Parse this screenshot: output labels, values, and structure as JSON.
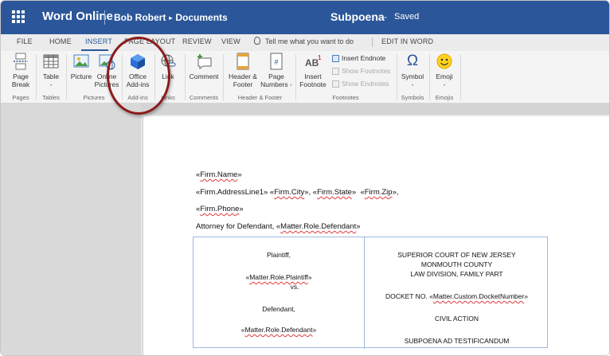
{
  "titlebar": {
    "app_name": "Word Online",
    "breadcrumb_user": "Bob Robert",
    "breadcrumb_arrow": "▸",
    "breadcrumb_folder": "Documents",
    "doc_name": "Subpoena",
    "doc_dash": "-",
    "doc_status": "Saved"
  },
  "tabs": {
    "file": "FILE",
    "home": "HOME",
    "insert": "INSERT",
    "page_layout": "PAGE LAYOUT",
    "review": "REVIEW",
    "view": "VIEW",
    "tell_me": "Tell me what you want to do",
    "edit_in_word": "EDIT IN WORD"
  },
  "ribbon": {
    "page_break": [
      "Page",
      "Break"
    ],
    "table": [
      "Table",
      "-"
    ],
    "picture": "Picture",
    "online_pictures": [
      "Online",
      "Pictures"
    ],
    "office_addins": [
      "Office",
      "Add-ins"
    ],
    "link": "Link",
    "comment": "Comment",
    "header_footer": [
      "Header &",
      "Footer"
    ],
    "page_numbers": [
      "Page",
      "Numbers -"
    ],
    "insert_footnote": [
      "Insert",
      "Footnote"
    ],
    "insert_endnote": "Insert Endnote",
    "show_footnotes": "Show Footnotes",
    "show_endnotes": "Show Endnotes",
    "symbol": [
      "Symbol",
      "-"
    ],
    "emoji": [
      "Emoji",
      "-"
    ],
    "groups": {
      "pages": "Pages",
      "tables": "Tables",
      "pictures": "Pictures",
      "addins": "Add-ins",
      "links": "Links",
      "comments": "Comments",
      "header_footer": "Header & Footer",
      "footnotes": "Footnotes",
      "symbols": "Symbols",
      "emojis": "Emojis"
    },
    "icons": {
      "ab_superscript": "AB",
      "ab_sup": "1",
      "omega": "Ω",
      "page_hash": "#"
    }
  },
  "document": {
    "firm_name_open": "«",
    "firm_name": "Firm.Name",
    "firm_name_close": "»",
    "address_line": "«Firm.AddressLine1» «",
    "firm_city": "Firm.City",
    "after_city": "», «",
    "firm_state": "Firm.State",
    "after_state": "»  «",
    "firm_zip": "Firm.Zip",
    "after_zip": "»,",
    "phone_open": "«",
    "firm_phone": "Firm.Phone",
    "phone_close": "»",
    "attorney_line": "Attorney for Defendant, «",
    "matter_role_defendant": "Matter.Role.Defendant",
    "attorney_close": "»",
    "left_cell": {
      "plaintiff": "Plaintiff,",
      "plaintiff_open": "«",
      "matter_role_plaintiff": "Matter.Role.Plaintiff",
      "plaintiff_close": "»",
      "vs": "vs.",
      "defendant": "Defendant,",
      "defendant_open": "«",
      "matter_role_defendant": "Matter.Role.Defendant",
      "defendant_close": "»"
    },
    "right_cell": {
      "court_1": "SUPERIOR COURT OF NEW JERSEY",
      "court_2": "MONMOUTH COUNTY",
      "court_3": "LAW DIVISION, FAMILY PART",
      "docket_prefix": "DOCKET NO. «",
      "docket_field": "Matter.Custom.DocketNumber",
      "docket_close": "»",
      "civil_action": "CIVIL ACTION",
      "subpoena": "SUBPOENA AD TESTIFICANDUM"
    }
  },
  "colors": {
    "titlebar": "#2b579a",
    "highlight_circle": "#8c1b1b",
    "squiggle": "#e03b3b"
  }
}
